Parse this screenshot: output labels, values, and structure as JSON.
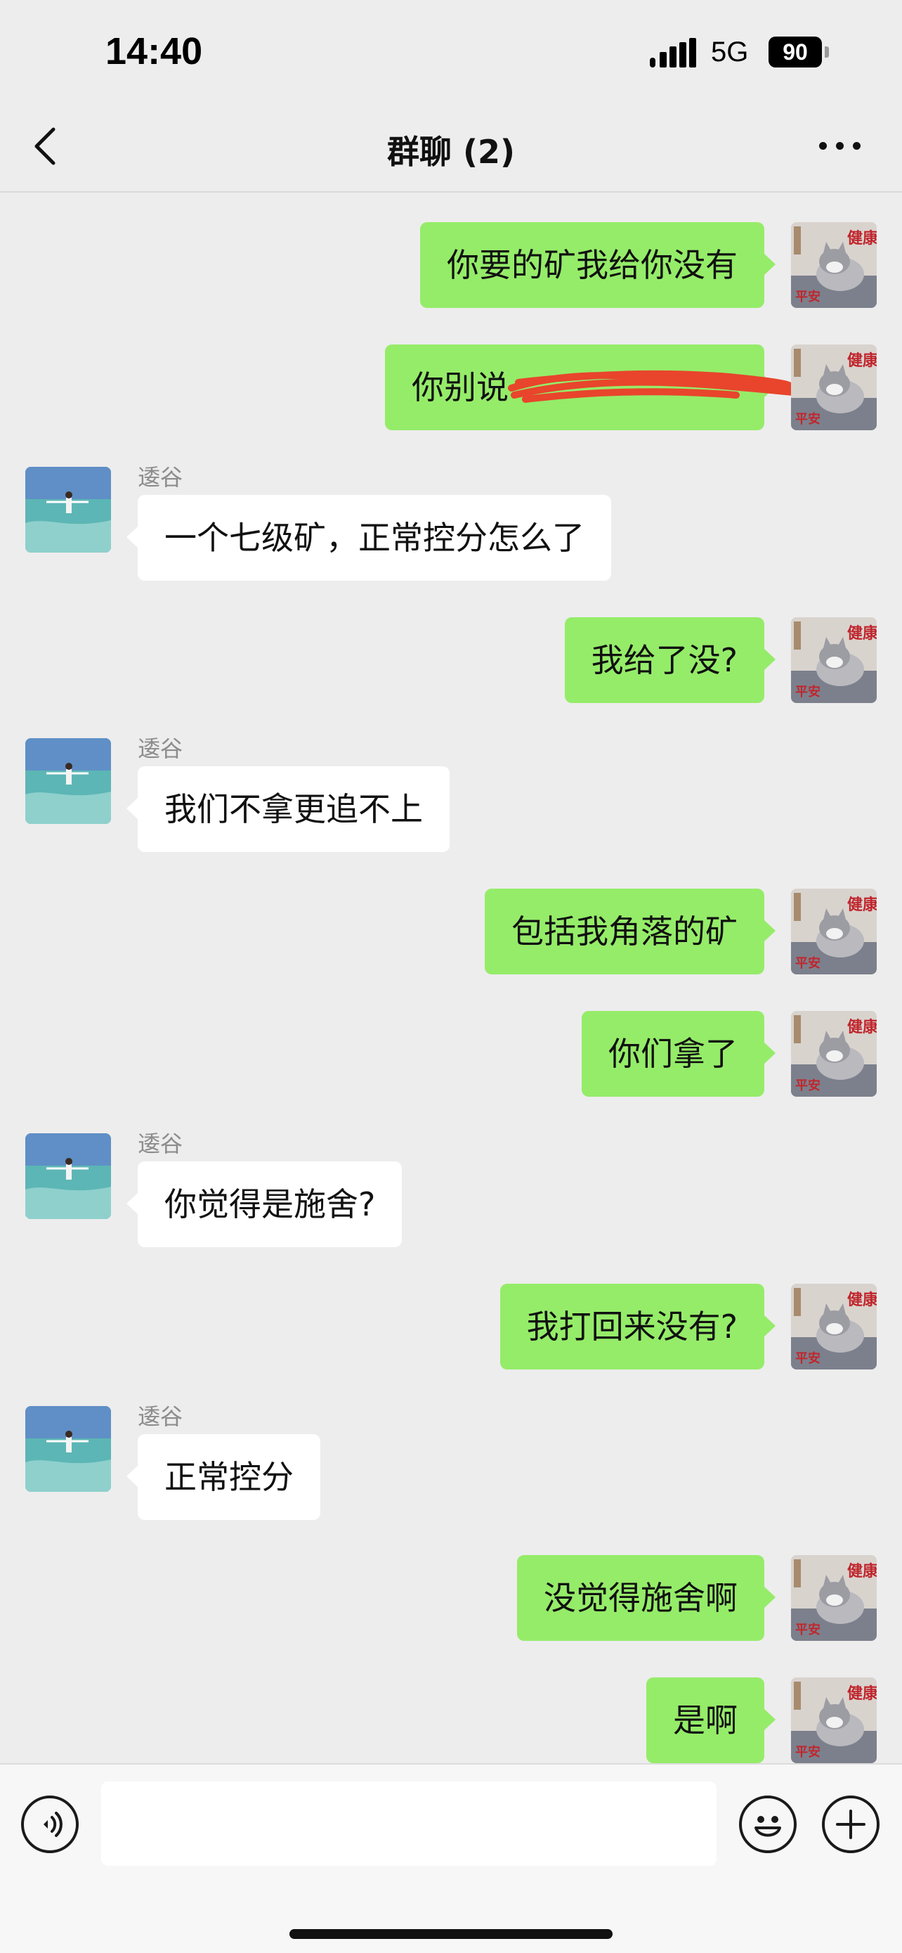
{
  "status_bar": {
    "time": "14:40",
    "network": "5G",
    "battery": "90"
  },
  "nav": {
    "title": "群聊 (2)",
    "back_icon": "chevron-left-icon",
    "more_icon": "ellipsis-icon"
  },
  "contact": {
    "name": "逶谷"
  },
  "messages": [
    {
      "from": "me",
      "text": "你要的矿我给你没有"
    },
    {
      "from": "me",
      "text": "你别说",
      "redacted": true
    },
    {
      "from": "other",
      "sender": "逶谷",
      "text": "一个七级矿，正常控分怎么了"
    },
    {
      "from": "me",
      "text": "我给了没?"
    },
    {
      "from": "other",
      "sender": "逶谷",
      "text": "我们不拿更追不上"
    },
    {
      "from": "me",
      "text": "包括我角落的矿"
    },
    {
      "from": "me",
      "text": "你们拿了"
    },
    {
      "from": "other",
      "sender": "逶谷",
      "text": "你觉得是施舍?"
    },
    {
      "from": "me",
      "text": "我打回来没有?"
    },
    {
      "from": "other",
      "sender": "逶谷",
      "text": "正常控分"
    },
    {
      "from": "me",
      "text": "没觉得施舍啊"
    },
    {
      "from": "me",
      "text": "是啊"
    }
  ],
  "input_bar": {
    "voice_icon": "voice-icon",
    "emoji_icon": "emoji-icon",
    "plus_icon": "plus-icon",
    "text": ""
  },
  "colors": {
    "my_bubble": "#95ec69",
    "their_bubble": "#ffffff",
    "background": "#ededed",
    "redaction": "#e8452c"
  }
}
